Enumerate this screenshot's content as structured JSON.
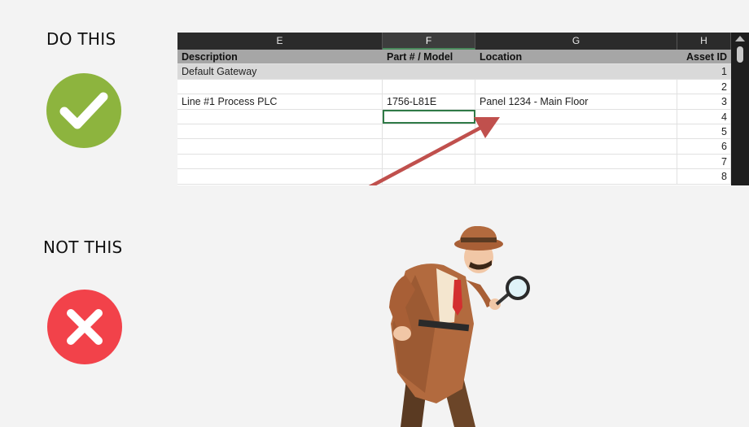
{
  "labels": {
    "do_this": "DO THIS",
    "not_this": "NOT THIS"
  },
  "icons": {
    "check": "check-mark-icon",
    "cross": "cross-mark-icon"
  },
  "colors": {
    "check_green": "#8db43e",
    "cross_red": "#f2424a",
    "arrow_red": "#c0504d",
    "active_cell": "#2f7a47"
  },
  "sheet": {
    "columns": [
      "E",
      "F",
      "G",
      "H"
    ],
    "selected_column": "F",
    "headers": [
      "Description",
      "Part # / Model",
      "Location",
      "Asset ID"
    ],
    "rows": [
      {
        "description": "Default Gateway",
        "part": "",
        "location": "",
        "asset_id": "1"
      },
      {
        "description": "",
        "part": "",
        "location": "",
        "asset_id": "2"
      },
      {
        "description": "Line #1 Process PLC",
        "part": "1756-L81E",
        "location": "Panel 1234 - Main Floor",
        "asset_id": "3"
      },
      {
        "description": "",
        "part": "",
        "location": "",
        "asset_id": "4"
      },
      {
        "description": "",
        "part": "",
        "location": "",
        "asset_id": "5"
      },
      {
        "description": "",
        "part": "",
        "location": "",
        "asset_id": "6"
      },
      {
        "description": "",
        "part": "",
        "location": "",
        "asset_id": "7"
      },
      {
        "description": "",
        "part": "",
        "location": "",
        "asset_id": "8"
      }
    ]
  },
  "illustration": {
    "name": "detective-with-magnifying-glass"
  }
}
